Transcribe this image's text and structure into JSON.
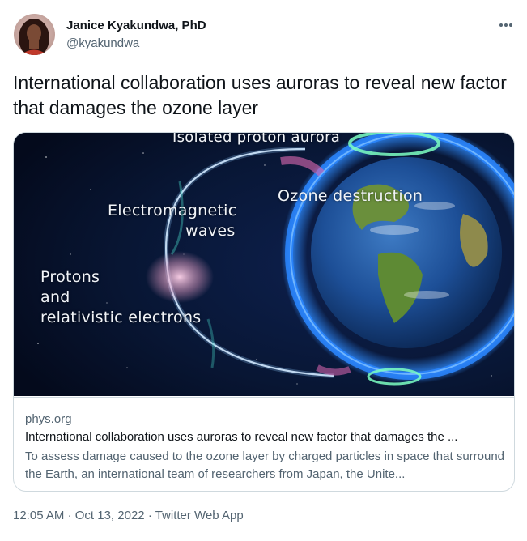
{
  "author": {
    "name": "Janice Kyakundwa, PhD",
    "handle": "@kyakundwa"
  },
  "more_icon": "more-horizontal-icon",
  "tweet": {
    "text": "International collaboration uses auroras to reveal new factor that damages the ozone layer"
  },
  "card": {
    "image_labels": {
      "isolated_proton_aurora": "Isolated proton aurora",
      "ozone_destruction": "Ozone destruction",
      "em_waves_line1": "Electromagnetic",
      "em_waves_line2": "waves",
      "protons_line1": "Protons",
      "protons_line2": "and",
      "protons_line3": "relativistic electrons"
    },
    "domain": "phys.org",
    "title": "International collaboration uses auroras to reveal new factor that damages the ...",
    "description": "To assess damage caused to the ozone layer by charged particles in space that surround the Earth, an international team of researchers from Japan, the Unite..."
  },
  "meta": {
    "time": "12:05 AM",
    "separator": "·",
    "date": "Oct 13, 2022",
    "source": "Twitter Web App"
  },
  "colors": {
    "text_primary": "#0f1419",
    "text_secondary": "#536471",
    "border": "#cfd9de"
  }
}
